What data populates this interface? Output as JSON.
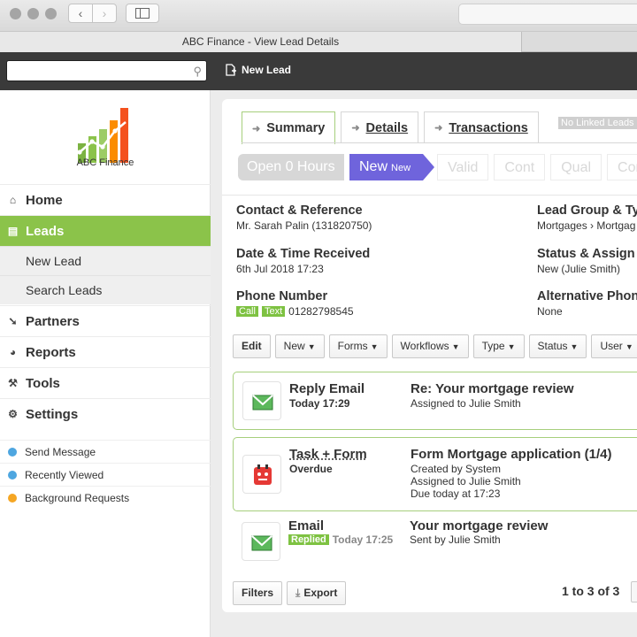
{
  "window": {
    "title": "ABC Finance - View Lead Details"
  },
  "app_toolbar": {
    "search_placeholder": "",
    "new_lead_label": "New Lead"
  },
  "sidebar": {
    "logo_text": "ABC Finance",
    "nav": [
      {
        "label": "Home",
        "icon": "home-icon"
      },
      {
        "label": "Leads",
        "icon": "leads-icon",
        "active": true
      },
      {
        "label": "Partners",
        "icon": "partners-icon"
      },
      {
        "label": "Reports",
        "icon": "reports-icon"
      },
      {
        "label": "Tools",
        "icon": "wrench-icon"
      },
      {
        "label": "Settings",
        "icon": "gear-icon"
      }
    ],
    "sub": [
      "New Lead",
      "Search Leads"
    ],
    "minor": [
      {
        "label": "Send Message",
        "color": "#4ea6e0"
      },
      {
        "label": "Recently Viewed",
        "color": "#4ea6e0"
      },
      {
        "label": "Background Requests",
        "color": "#f5a623"
      }
    ]
  },
  "tabs": [
    {
      "label": "Summary",
      "selected": true
    },
    {
      "label": "Details"
    },
    {
      "label": "Transactions"
    }
  ],
  "linked_leads_label": "No Linked Leads",
  "pipeline": {
    "open_label": "Open 0 Hours",
    "current": "New",
    "current_small": "New",
    "stages": [
      "Valid",
      "Cont",
      "Qual",
      "Conv"
    ]
  },
  "info": {
    "contact": {
      "head": "Contact & Reference",
      "value": "Mr. Sarah Palin (131820750)"
    },
    "lead_group": {
      "head": "Lead Group & Ty",
      "value": "Mortgages › Mortgag"
    },
    "received": {
      "head": "Date & Time Received",
      "value": "6th Jul 2018 17:23"
    },
    "status": {
      "head": "Status & Assign",
      "value": "New (Julie Smith)"
    },
    "phone": {
      "head": "Phone Number",
      "call": "Call",
      "text": "Text",
      "value": "01282798545"
    },
    "alt_phone": {
      "head": "Alternative Phon",
      "value": "None"
    }
  },
  "actions": [
    "Edit",
    "New",
    "Forms",
    "Workflows",
    "Type",
    "Status",
    "User"
  ],
  "events": [
    {
      "type": "Reply Email",
      "sub": "Today 17:29",
      "title": "Re: Your mortgage review",
      "lines": [
        "Assigned to Julie Smith"
      ]
    },
    {
      "type": "Task + Form",
      "sub": "Overdue",
      "title": "Form Mortgage application (1/4)",
      "lines": [
        "Created by System",
        "Assigned to Julie Smith",
        "Due today at 17:23"
      ]
    },
    {
      "type": "Email",
      "badge": "Replied",
      "sub": "Today 17:25",
      "title": "Your mortgage review",
      "lines": [
        "Sent by Julie Smith"
      ]
    }
  ],
  "footer": {
    "filters": "Filters",
    "export": "Export",
    "pager": "1 to 3 of 3"
  },
  "colors": {
    "accent_green": "#8bc34a",
    "stage_purple": "#6f64dc",
    "task_red": "#e53935"
  }
}
